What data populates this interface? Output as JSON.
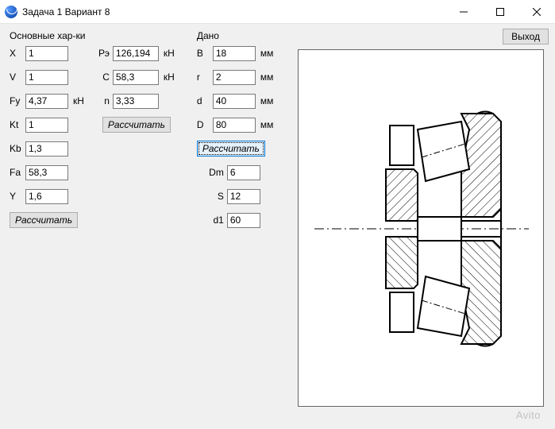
{
  "window": {
    "title": "Задача 1 Вариант 8"
  },
  "buttons": {
    "exit": "Выход",
    "calc": "Рассчитать"
  },
  "sections": {
    "main": "Основные хар-ки",
    "given": "Дано"
  },
  "col1": {
    "X": {
      "label": "X",
      "value": "1"
    },
    "V": {
      "label": "V",
      "value": "1"
    },
    "Fy": {
      "label": "Fy",
      "value": "4,37",
      "unit": "кН"
    },
    "Kt": {
      "label": "Kt",
      "value": "1"
    },
    "Kb": {
      "label": "Kb",
      "value": "1,3"
    },
    "Fa": {
      "label": "Fa",
      "value": "58,3"
    },
    "Y": {
      "label": "Y",
      "value": "1,6"
    }
  },
  "col2": {
    "Re": {
      "label": "Рэ",
      "value": "126,194",
      "unit": "кН"
    },
    "C": {
      "label": "С",
      "value": "58,3",
      "unit": "кН"
    },
    "n": {
      "label": "n",
      "value": "3,33"
    }
  },
  "given_col": {
    "B": {
      "label": "В",
      "value": "18",
      "unit": "мм"
    },
    "r": {
      "label": "r",
      "value": "2",
      "unit": "мм"
    },
    "d": {
      "label": "d",
      "value": "40",
      "unit": "мм"
    },
    "D": {
      "label": "D",
      "value": "80",
      "unit": "мм"
    }
  },
  "given_sub": {
    "Dm": {
      "label": "Dm",
      "value": "6"
    },
    "S": {
      "label": "S",
      "value": "12"
    },
    "d1": {
      "label": "d1",
      "value": "60"
    }
  },
  "watermark": "Avito"
}
